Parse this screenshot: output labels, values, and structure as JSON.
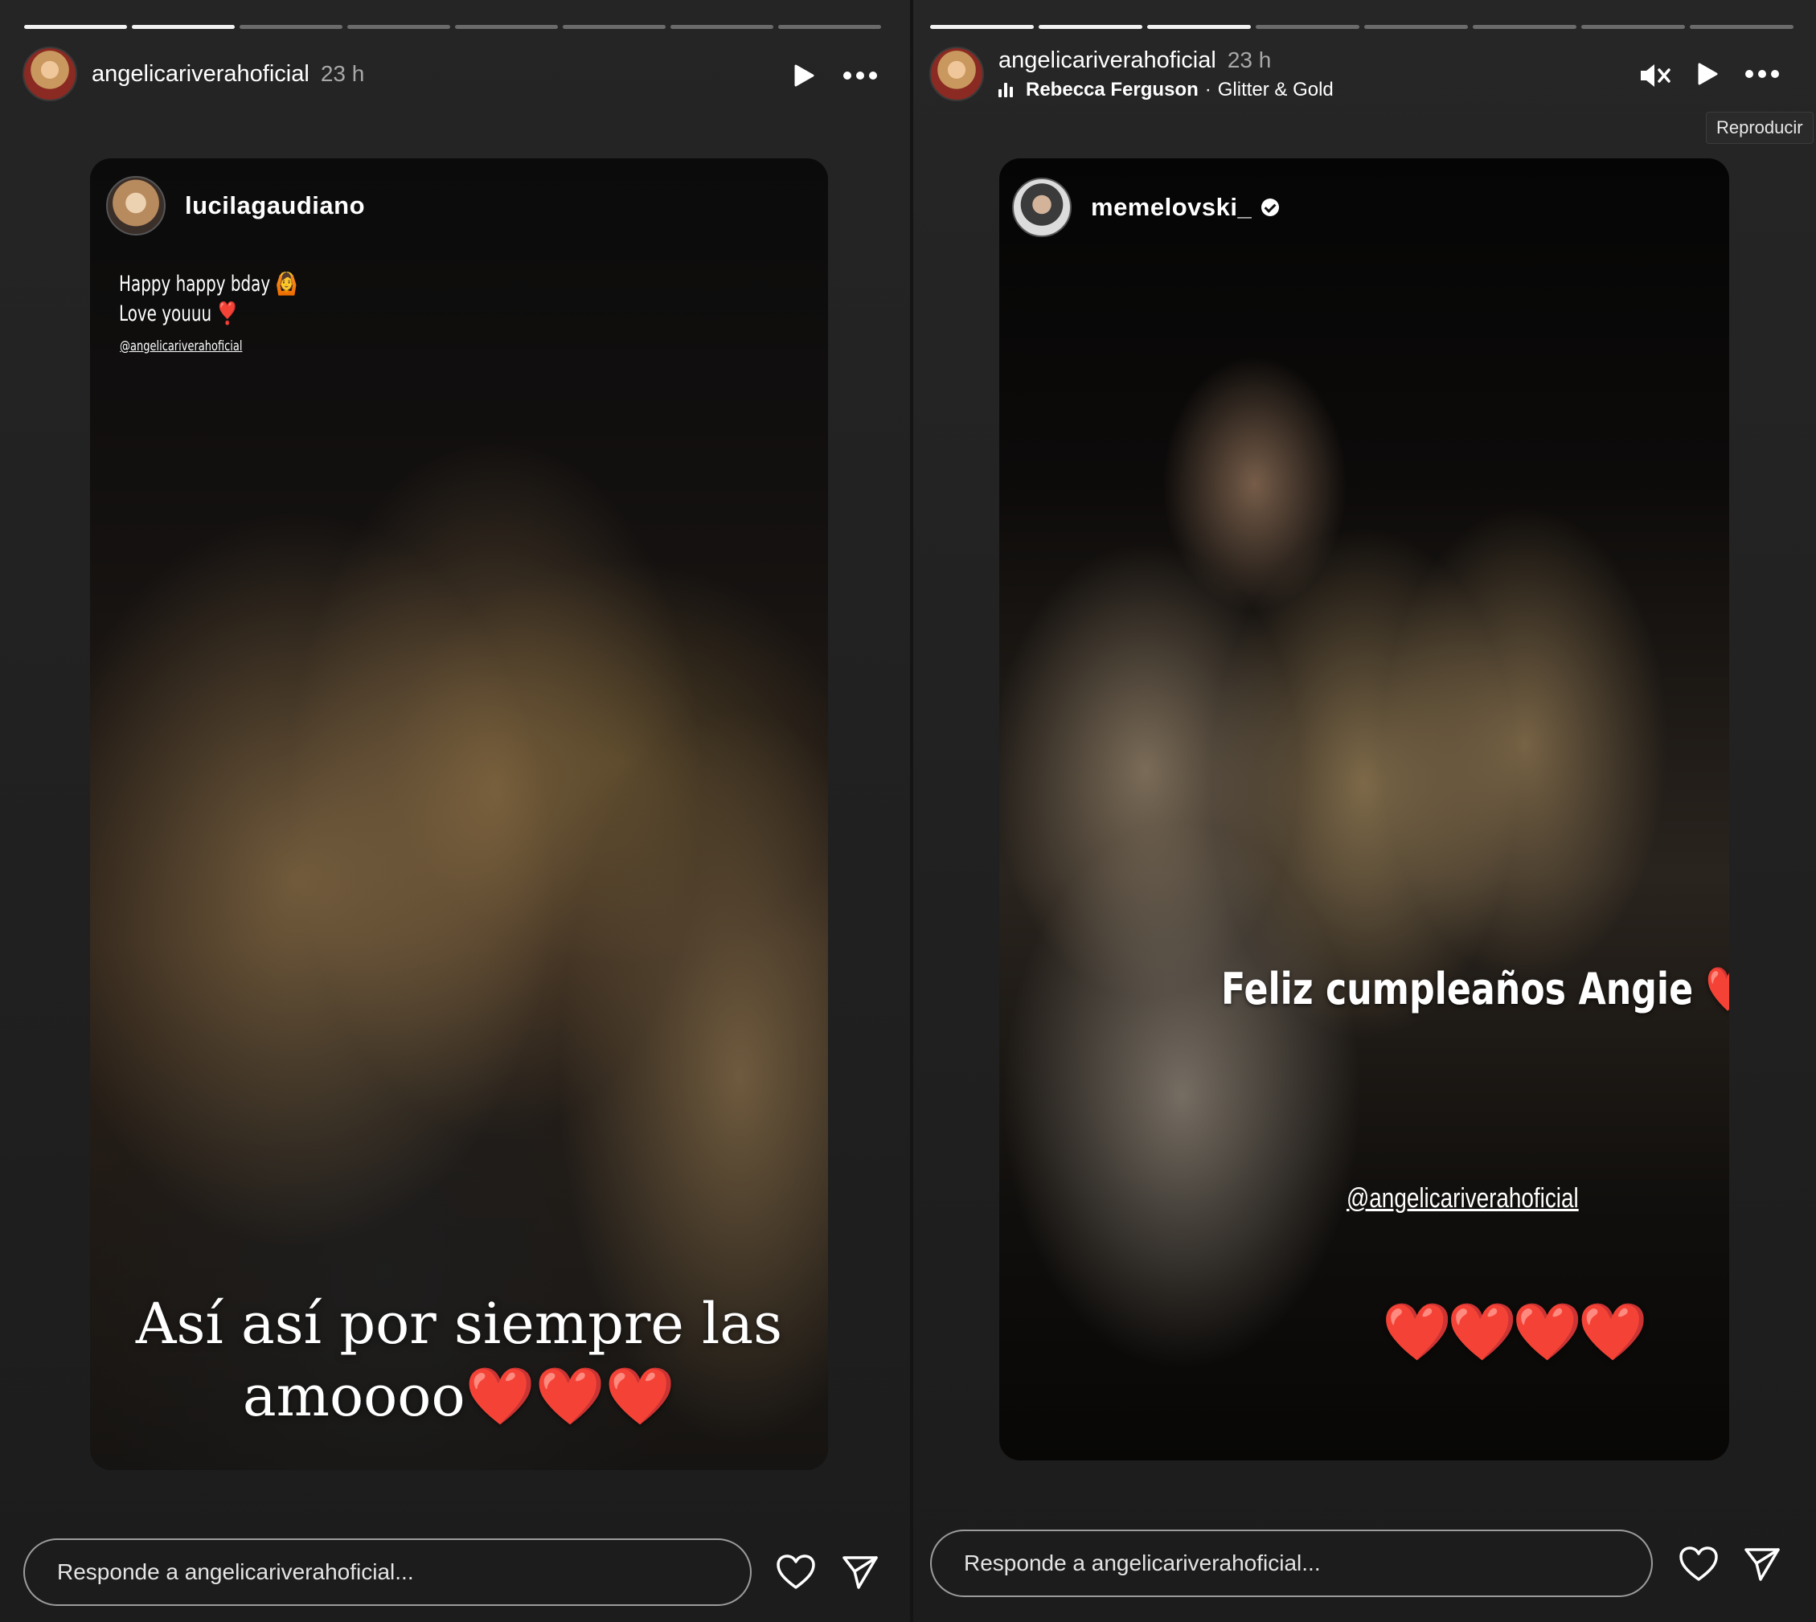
{
  "left": {
    "progress": {
      "total": 8,
      "completed": 2
    },
    "header": {
      "username": "angelicariverahoficial",
      "time": "23 h"
    },
    "story": {
      "author": "lucilagaudiano",
      "note_line1": "Happy happy bday 🙆",
      "note_line2": "Love youuu ❣️",
      "mention": "@angelicariverahoficial",
      "caption_line1": "Así así por siempre las",
      "caption_line2": "amoooo",
      "caption_hearts": "❤️❤️❤️"
    },
    "reply_placeholder": "Responde a angelicariverahoficial..."
  },
  "right": {
    "progress": {
      "total": 8,
      "completed": 3
    },
    "header": {
      "username": "angelicariverahoficial",
      "time": "23 h",
      "song_artist": "Rebecca Ferguson",
      "song_separator": "·",
      "song_title": "Glitter & Gold"
    },
    "tooltip": "Reproducir",
    "story": {
      "author": "memelovski_",
      "caption": "Feliz cumpleaños Angie ❤️",
      "mention": "@angelicariverahoficial",
      "hearts": "❤️❤️❤️❤️"
    },
    "reply_placeholder": "Responde a angelicariverahoficial..."
  },
  "icons": {
    "play": "play-icon",
    "more": "more-options-icon",
    "mute": "muted-speaker-icon",
    "music": "music-bars-icon",
    "like": "heart-outline-icon",
    "share": "send-paper-plane-icon",
    "verified": "verified-badge-icon"
  },
  "colors": {
    "background": "#1b1b1b",
    "progress_done": "#f2f2f2",
    "progress_pending": "#6b6b6b",
    "heart": "#e01b1b"
  }
}
